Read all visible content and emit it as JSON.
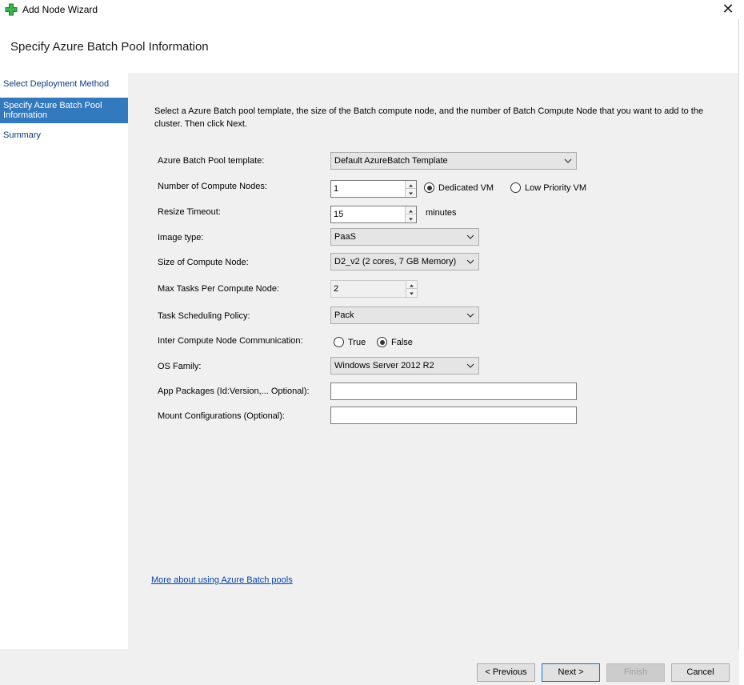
{
  "window": {
    "title": "Add Node Wizard",
    "close_glyph": "✕"
  },
  "header": {
    "title": "Specify Azure Batch Pool Information"
  },
  "sidebar": {
    "items": [
      {
        "label": "Select Deployment Method",
        "active": false
      },
      {
        "label": "Specify Azure Batch Pool Information",
        "active": true
      },
      {
        "label": "Summary",
        "active": false
      }
    ]
  },
  "intro": "Select a Azure Batch pool template, the size of the Batch compute node, and the number of Batch Compute Node that you want to add to the cluster. Then click Next.",
  "form": {
    "pool_template": {
      "label": "Azure Batch Pool template:",
      "value": "Default AzureBatch Template"
    },
    "compute_nodes": {
      "label": "Number of Compute Nodes:",
      "value": "1"
    },
    "vm_type": {
      "dedicated": "Dedicated VM",
      "low_priority": "Low Priority VM",
      "selected": "dedicated"
    },
    "resize_timeout": {
      "label": "Resize Timeout:",
      "value": "15",
      "unit": "minutes"
    },
    "image_type": {
      "label": "Image type:",
      "value": "PaaS"
    },
    "node_size": {
      "label": "Size of Compute Node:",
      "value": "D2_v2 (2 cores, 7 GB Memory)"
    },
    "max_tasks": {
      "label": "Max Tasks Per Compute Node:",
      "value": "2"
    },
    "scheduling_policy": {
      "label": "Task Scheduling Policy:",
      "value": "Pack"
    },
    "inter_node_comm": {
      "label": "Inter Compute Node Communication:",
      "true_label": "True",
      "false_label": "False",
      "selected": "false"
    },
    "os_family": {
      "label": "OS Family:",
      "value": "Windows Server 2012 R2"
    },
    "app_packages": {
      "label": "App Packages (Id:Version,... Optional):",
      "value": ""
    },
    "mount_configs": {
      "label": "Mount Configurations (Optional):",
      "value": ""
    }
  },
  "more_link": "More about using Azure Batch pools",
  "buttons": {
    "previous": "< Previous",
    "next": "Next >",
    "finish": "Finish",
    "cancel": "Cancel"
  },
  "colors": {
    "accent": "#3379be",
    "link": "#0645ad",
    "icon_green": "#3cb34a"
  }
}
